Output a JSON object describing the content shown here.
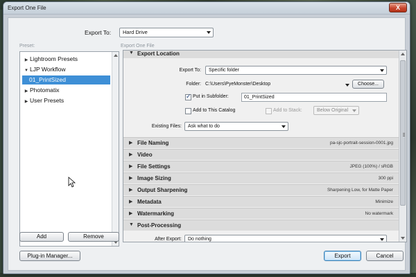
{
  "window": {
    "title": "Export One File",
    "close": "X"
  },
  "export_to": {
    "label": "Export To:",
    "value": "Hard Drive"
  },
  "preset": {
    "label": "Preset:",
    "items": [
      {
        "label": "Lightroom Presets",
        "expanded": false
      },
      {
        "label": "LJP Workflow",
        "expanded": true
      },
      {
        "label": "01_PrintSized",
        "selected": true
      },
      {
        "label": "Photomatix",
        "expanded": false
      },
      {
        "label": "User Presets",
        "expanded": false
      }
    ],
    "add_label": "Add",
    "remove_label": "Remove"
  },
  "main": {
    "panel_label": "Export One File",
    "export_location": {
      "title": "Export Location",
      "export_to_label": "Export To:",
      "export_to_value": "Specific folder",
      "folder_label": "Folder:",
      "folder_value": "C:\\Users\\PyeMonster\\Desktop",
      "choose_label": "Choose...",
      "subfolder_label": "Put in Subfolder:",
      "subfolder_checked": true,
      "subfolder_value": "01_PrintSized",
      "catalog_label": "Add to This Catalog",
      "stack_label": "Add to Stack:",
      "stack_value": "Below Original",
      "existing_label": "Existing Files:",
      "existing_value": "Ask what to do"
    },
    "sections": [
      {
        "name": "File Naming",
        "summary": "pa-sjc-portrait-session-0001.jpg"
      },
      {
        "name": "Video",
        "summary": ""
      },
      {
        "name": "File Settings",
        "summary": "JPEG (100%) / sRGB"
      },
      {
        "name": "Image Sizing",
        "summary": "300 ppi"
      },
      {
        "name": "Output Sharpening",
        "summary": "Sharpening Low, for Matte Paper"
      },
      {
        "name": "Metadata",
        "summary": "Minimize"
      },
      {
        "name": "Watermarking",
        "summary": "No watermark"
      }
    ],
    "post_processing": {
      "title": "Post-Processing",
      "after_export_label": "After Export:",
      "after_export_value": "Do nothing"
    }
  },
  "footer": {
    "plugin_manager_label": "Plug-in Manager...",
    "export_label": "Export",
    "cancel_label": "Cancel"
  }
}
